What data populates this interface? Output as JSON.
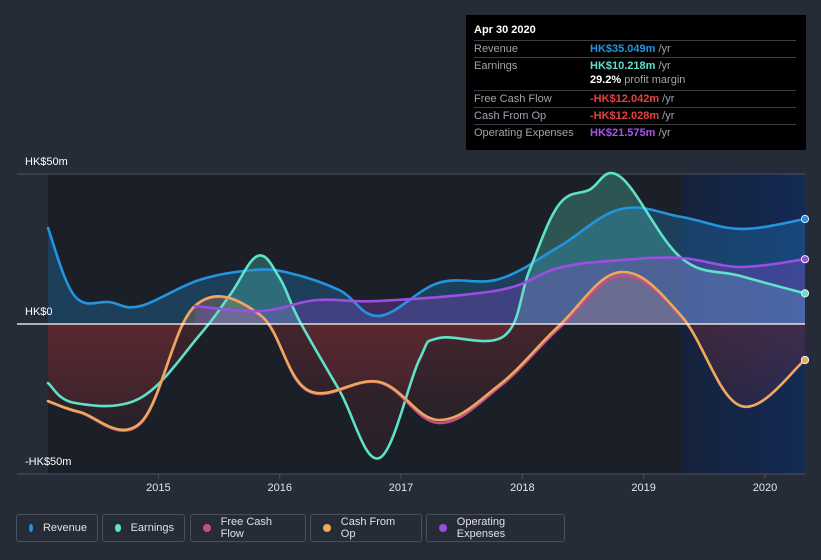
{
  "chart_data": {
    "type": "area",
    "title": "",
    "currency": "HK$",
    "ylabel": "",
    "xlabel": "",
    "ylim": [
      -50,
      50
    ],
    "xlim": [
      2014.09,
      2020.33
    ],
    "y_ticks": [
      {
        "value": 50,
        "label": "HK$50m"
      },
      {
        "value": 0,
        "label": "HK$0"
      },
      {
        "value": -50,
        "label": "-HK$50m"
      }
    ],
    "x_ticks": [
      {
        "value": 2015,
        "label": "2015"
      },
      {
        "value": 2016,
        "label": "2016"
      },
      {
        "value": 2017,
        "label": "2017"
      },
      {
        "value": 2018,
        "label": "2018"
      },
      {
        "value": 2019,
        "label": "2019"
      },
      {
        "value": 2020,
        "label": "2020"
      }
    ],
    "highlight_from": 2019.31,
    "grid": false,
    "legend_position": "bottom-left",
    "series": [
      {
        "name": "Revenue",
        "color": "#2394df",
        "x": [
          2014.09,
          2014.31,
          2014.6,
          2014.85,
          2015.34,
          2015.79,
          2016.08,
          2016.49,
          2016.82,
          2017.31,
          2017.81,
          2018.3,
          2018.81,
          2019.31,
          2019.8,
          2020.33
        ],
        "values": [
          32,
          9.3,
          7.3,
          6,
          14.7,
          18,
          17,
          11.3,
          2.7,
          13.7,
          15,
          25.7,
          38.3,
          35.7,
          31.7,
          35.0
        ]
      },
      {
        "name": "Earnings",
        "color": "#5ee2c8",
        "x": [
          2014.09,
          2014.31,
          2014.85,
          2015.34,
          2015.59,
          2015.82,
          2016.0,
          2016.16,
          2016.49,
          2016.82,
          2017.15,
          2017.31,
          2017.85,
          2018.06,
          2018.3,
          2018.55,
          2018.81,
          2019.31,
          2019.8,
          2020.33
        ],
        "values": [
          -19.7,
          -26.3,
          -24.7,
          -3.7,
          9.7,
          22.7,
          15.3,
          1.3,
          -22,
          -44.7,
          -12,
          -4.7,
          -4,
          18,
          39.7,
          44.7,
          49,
          22,
          16,
          10.2
        ]
      },
      {
        "name": "Free Cash Flow",
        "color": "#c84b8a",
        "x": [
          2014.09,
          2014.35,
          2014.85,
          2015.3,
          2015.84,
          2016.23,
          2016.82,
          2017.31,
          2017.81,
          2018.3,
          2018.81,
          2019.31,
          2019.8,
          2020.33
        ],
        "values": [
          -25.7,
          -29.5,
          -33.3,
          5.8,
          2.8,
          -22.3,
          -19.5,
          -33,
          -21,
          -1.5,
          16,
          2.5,
          -27.3,
          -12.0
        ]
      },
      {
        "name": "Cash From Op",
        "color": "#eaa95c",
        "x": [
          2014.09,
          2014.35,
          2014.85,
          2015.3,
          2015.84,
          2016.23,
          2016.82,
          2017.31,
          2017.81,
          2018.3,
          2018.81,
          2019.31,
          2019.8,
          2020.33
        ],
        "values": [
          -25.7,
          -29.3,
          -33,
          6,
          3,
          -22,
          -19.3,
          -32,
          -20.3,
          -0.7,
          17.3,
          2.7,
          -27.3,
          -12.0
        ]
      },
      {
        "name": "Operating Expenses",
        "color": "#9d4de3",
        "x": [
          2015.3,
          2015.84,
          2016.31,
          2016.82,
          2017.81,
          2018.3,
          2018.81,
          2019.31,
          2019.8,
          2020.33
        ],
        "values": [
          6,
          4.3,
          8,
          7.7,
          11.3,
          18.7,
          21.3,
          22,
          19,
          21.6
        ]
      }
    ]
  },
  "tooltip": {
    "date": "Apr 30 2020",
    "rows": [
      {
        "label": "Revenue",
        "value": "HK$35.049m",
        "unit": " /yr",
        "color": "#2394df"
      },
      {
        "label": "Earnings",
        "value": "HK$10.218m",
        "unit": " /yr",
        "color": "#5ee2c8"
      },
      {
        "label": "Free Cash Flow",
        "value": "-HK$12.042m",
        "unit": " /yr",
        "color": "#e6413f"
      },
      {
        "label": "Cash From Op",
        "value": "-HK$12.028m",
        "unit": " /yr",
        "color": "#e6413f"
      },
      {
        "label": "Operating Expenses",
        "value": "HK$21.575m",
        "unit": " /yr",
        "color": "#a855f0"
      }
    ],
    "margin_value": "29.2%",
    "margin_label": " profit margin"
  },
  "legend": [
    {
      "label": "Revenue",
      "color": "#2394df"
    },
    {
      "label": "Earnings",
      "color": "#5ee2c8"
    },
    {
      "label": "Free Cash Flow",
      "color": "#c84b8a"
    },
    {
      "label": "Cash From Op",
      "color": "#eaa95c"
    },
    {
      "label": "Operating Expenses",
      "color": "#9d4de3"
    }
  ]
}
